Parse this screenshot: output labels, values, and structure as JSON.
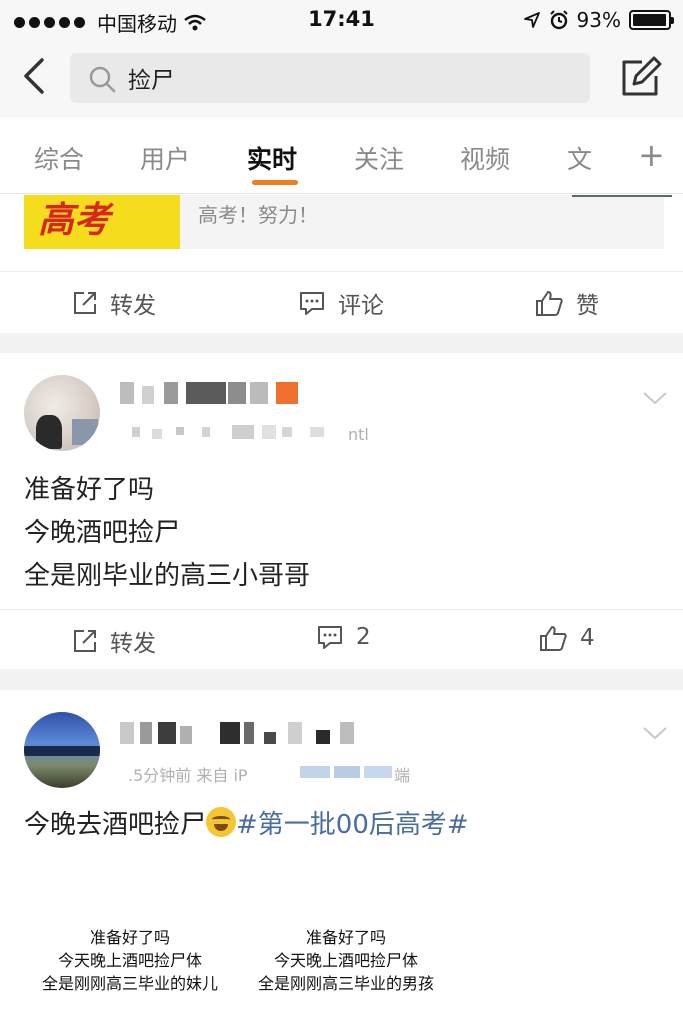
{
  "status_bar": {
    "carrier": "中国移动",
    "time": "17:41",
    "battery": "93%",
    "battery_level": 0.93
  },
  "search": {
    "query": "捡尸"
  },
  "tabs": [
    {
      "label": "综合",
      "active": false
    },
    {
      "label": "用户",
      "active": false
    },
    {
      "label": "实时",
      "active": true
    },
    {
      "label": "关注",
      "active": false
    },
    {
      "label": "视频",
      "active": false
    },
    {
      "label": "文",
      "active": false
    }
  ],
  "tabs_add_label": "+",
  "colors": {
    "accent": "#f07d1f",
    "hashtag": "#4a6d9e",
    "text_secondary": "#8a8a8a"
  },
  "posts": [
    {
      "quoted_image_text": "高考",
      "quoted_text": "高考！努力！",
      "actions": {
        "repost": "转发",
        "comment": "评论",
        "like": "赞"
      }
    },
    {
      "source_suffix": "ntl",
      "lines": [
        "准备好了吗",
        "今晚酒吧捡尸",
        "全是刚毕业的高三小哥哥"
      ],
      "actions": {
        "repost": "转发",
        "comment": "2",
        "like": "4"
      }
    },
    {
      "meta_partial": ".5分钟前  来自 iP",
      "meta_suffix": "端",
      "text": "今晚去酒吧捡尸",
      "hashtag": "#第一批00后高考#",
      "image_captions": [
        [
          "准备好了吗",
          "今天晚上酒吧捡尸体",
          "全是刚刚高三毕业的妹儿"
        ],
        [
          "准备好了吗",
          "今天晚上酒吧捡尸体",
          "全是刚刚高三毕业的男孩"
        ]
      ]
    }
  ]
}
